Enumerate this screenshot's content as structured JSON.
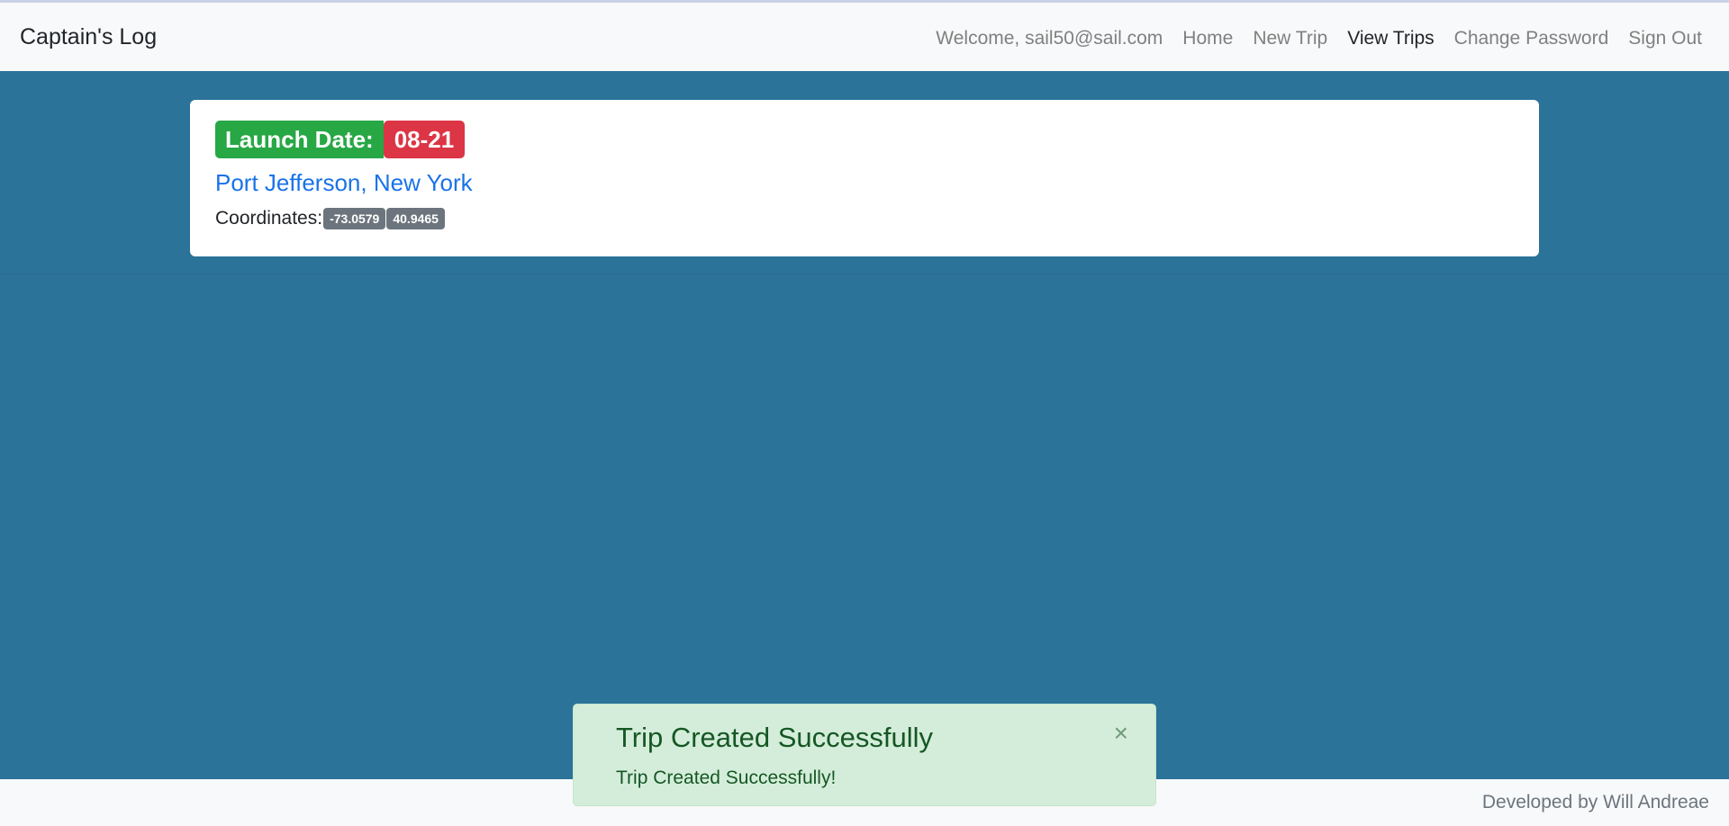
{
  "navbar": {
    "brand": "Captain's Log",
    "welcome": "Welcome, sail50@sail.com",
    "links": [
      {
        "label": "Home"
      },
      {
        "label": "New Trip"
      },
      {
        "label": "View Trips"
      },
      {
        "label": "Change Password"
      },
      {
        "label": "Sign Out"
      }
    ],
    "active": "View Trips"
  },
  "trip": {
    "launch_label": "Launch Date:",
    "launch_date": "08-21",
    "location": "Port Jefferson, New York",
    "coordinates_label": "Coordinates:",
    "longitude": "-73.0579",
    "latitude": "40.9465"
  },
  "toast": {
    "title": "Trip Created Successfully",
    "body": "Trip Created Successfully!",
    "close_glyph": "×"
  },
  "footer": {
    "text": "Developed by Will Andreae"
  },
  "colors": {
    "background": "#2b7399",
    "launch_badge": "#28a745",
    "date_badge": "#dc3545",
    "coord_badge": "#6c757d",
    "toast_bg": "#d4edda",
    "link": "#1a73e8"
  }
}
